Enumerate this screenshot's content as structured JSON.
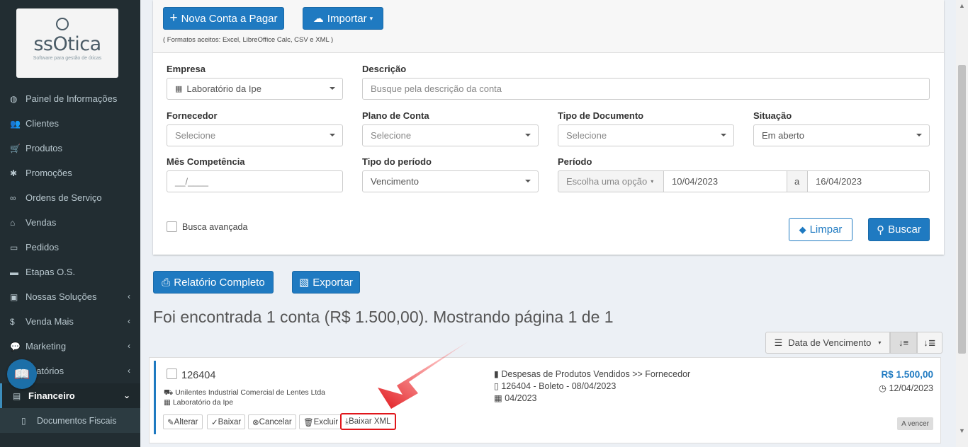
{
  "brand": {
    "name": "ssOtica",
    "tagline": "Software para gestão de óticas"
  },
  "sidebar": {
    "items": [
      {
        "label": "Painel de Informações",
        "icon": "dashboard-icon"
      },
      {
        "label": "Clientes",
        "icon": "users-icon"
      },
      {
        "label": "Produtos",
        "icon": "cart-icon"
      },
      {
        "label": "Promoções",
        "icon": "asterisk-icon"
      },
      {
        "label": "Ordens de Serviço",
        "icon": "glasses-icon"
      },
      {
        "label": "Vendas",
        "icon": "basket-icon"
      },
      {
        "label": "Pedidos",
        "icon": "inbox-icon"
      },
      {
        "label": "Etapas O.S.",
        "icon": "card-icon"
      },
      {
        "label": "Nossas Soluções",
        "icon": "briefcase-icon"
      },
      {
        "label": "Venda Mais",
        "icon": "dollar-icon"
      },
      {
        "label": "Marketing",
        "icon": "comments-icon"
      },
      {
        "label": "elatórios",
        "icon": "chart-icon"
      },
      {
        "label": "Financeiro",
        "icon": "money-icon"
      },
      {
        "label": "Documentos Fiscais",
        "icon": "file-icon"
      }
    ]
  },
  "toolbar": {
    "new_label": "Nova Conta a Pagar",
    "import_label": "Importar",
    "formats": "( Formatos aceitos: Excel, LibreOffice Calc, CSV e XML )"
  },
  "filters": {
    "empresa_label": "Empresa",
    "empresa_value": "Laboratório da Ipe",
    "descricao_label": "Descrição",
    "descricao_placeholder": "Busque pela descrição da conta",
    "fornecedor_label": "Fornecedor",
    "fornecedor_value": "Selecione",
    "plano_label": "Plano de Conta",
    "plano_value": "Selecione",
    "tipo_doc_label": "Tipo de Documento",
    "tipo_doc_value": "Selecione",
    "situacao_label": "Situação",
    "situacao_value": "Em aberto",
    "mes_label": "Mês Competência",
    "mes_placeholder": "__/____",
    "tipo_periodo_label": "Tipo do período",
    "tipo_periodo_value": "Vencimento",
    "periodo_label": "Período",
    "periodo_option": "Escolha uma opção",
    "periodo_start": "10/04/2023",
    "periodo_sep": "a",
    "periodo_end": "16/04/2023",
    "advanced_label": "Busca avançada",
    "clear_label": "Limpar",
    "search_label": "Buscar"
  },
  "reports": {
    "full_label": "Relatório Completo",
    "export_label": "Exportar"
  },
  "results": {
    "summary": "Foi encontrada 1 conta (R$ 1.500,00). Mostrando página 1 de 1"
  },
  "sort": {
    "field": "Data de Vencimento"
  },
  "account": {
    "number": "126404",
    "supplier": "Unilentes Industrial Comercial de Lentes Ltda",
    "company": "Laboratório da Ipe",
    "category": "Despesas de Produtos Vendidos >> Fornecedor",
    "document": "126404 - Boleto - 08/04/2023",
    "competence": "04/2023",
    "amount": "R$ 1.500,00",
    "due_date": "12/04/2023",
    "status": "A vencer",
    "actions": {
      "edit": "Alterar",
      "pay": "Baixar",
      "cancel": "Cancelar",
      "delete": "Excluir",
      "xml": "Baixar XML"
    }
  },
  "colors": {
    "primary": "#1f7ac1",
    "sidebar": "#222d32",
    "highlight": "#e0161b"
  }
}
